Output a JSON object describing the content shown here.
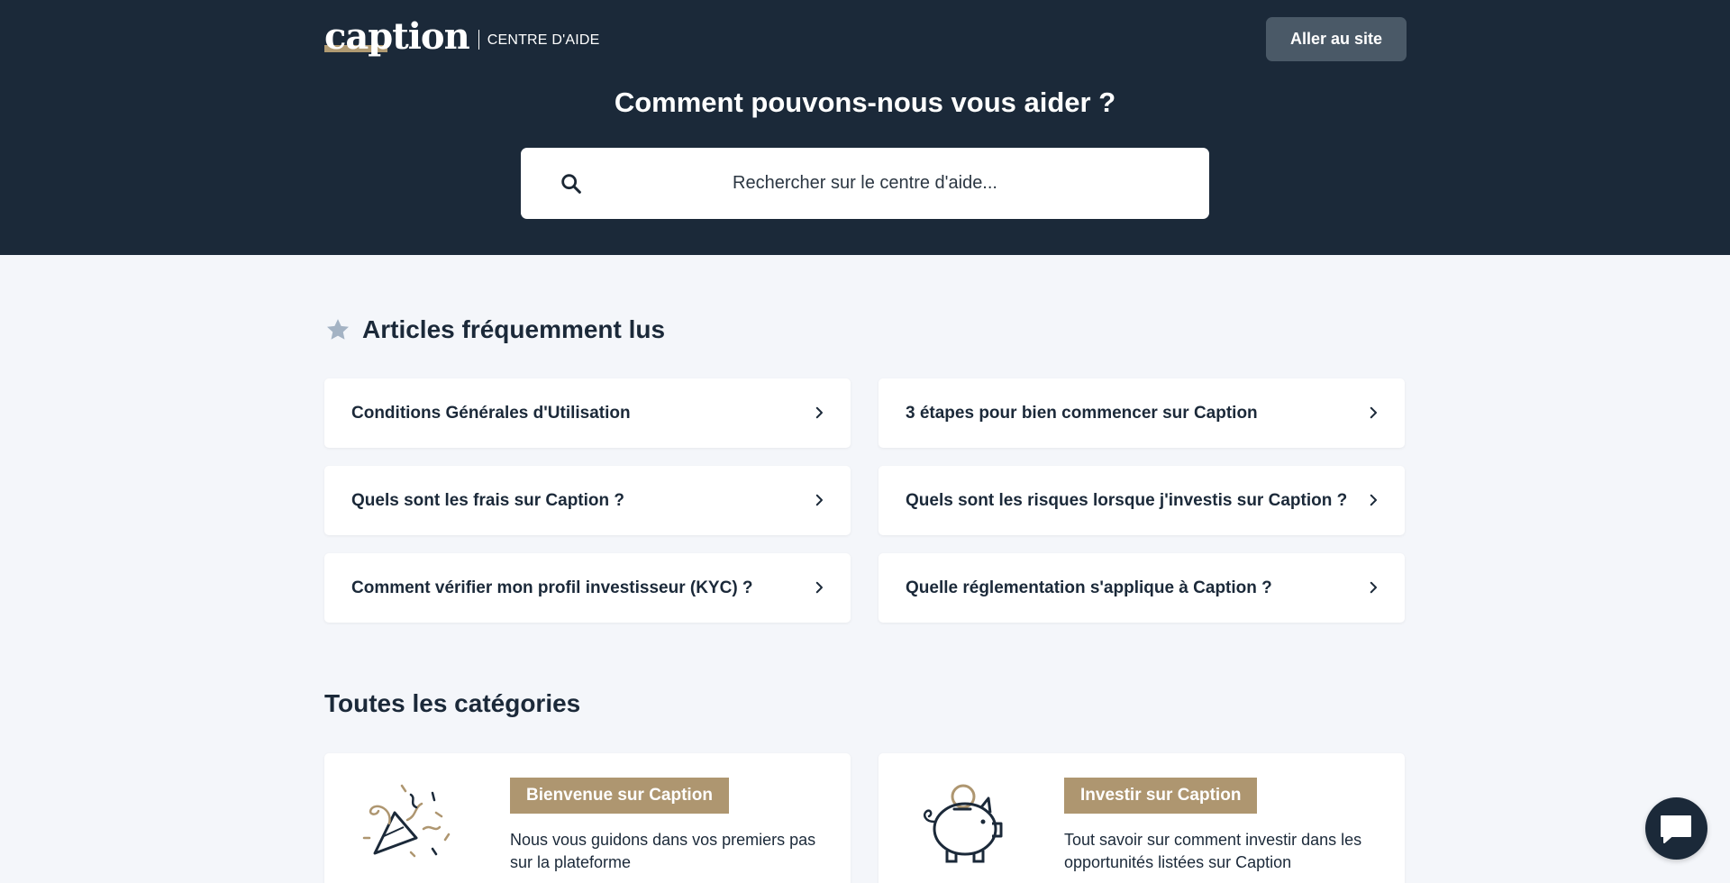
{
  "header": {
    "logo_text": "caption",
    "logo_subtitle": "CENTRE D'AIDE",
    "site_button_label": "Aller au site",
    "title": "Comment pouvons-nous vous aider ?"
  },
  "search": {
    "placeholder": "Rechercher sur le centre d'aide...",
    "value": ""
  },
  "popular": {
    "title": "Articles fréquemment lus",
    "articles": [
      {
        "label": "Conditions Générales d'Utilisation"
      },
      {
        "label": "3 étapes pour bien commencer sur Caption"
      },
      {
        "label": "Quels sont les frais sur Caption ?"
      },
      {
        "label": "Quels sont les risques lorsque j'investis sur Caption ?"
      },
      {
        "label": "Comment vérifier mon profil investisseur (KYC) ?"
      },
      {
        "label": "Quelle réglementation s'applique à Caption ?"
      }
    ]
  },
  "categories": {
    "title": "Toutes les catégories",
    "items": [
      {
        "label": "Bienvenue sur Caption",
        "description": "Nous vous guidons dans vos premiers pas sur la plateforme",
        "icon": "party-popper-icon"
      },
      {
        "label": "Investir sur Caption",
        "description": "Tout savoir sur comment investir dans les opportunités listées sur Caption",
        "icon": "piggy-bank-icon"
      }
    ]
  },
  "colors": {
    "header_bg": "#1b2939",
    "page_bg": "#f4f6fa",
    "accent_gold": "#ae9670",
    "button_bg": "#4a5967"
  }
}
